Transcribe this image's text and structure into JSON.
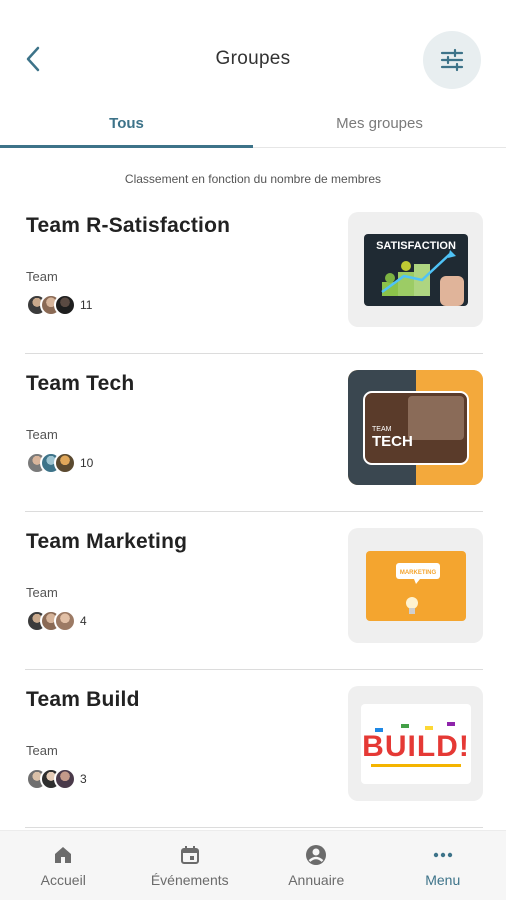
{
  "header": {
    "title": "Groupes",
    "back_icon": "chevron-left-icon",
    "filter_icon": "sliders-icon"
  },
  "tabs": [
    {
      "label": "Tous",
      "active": true
    },
    {
      "label": "Mes groupes",
      "active": false
    }
  ],
  "list_subtitle": "Classement en fonction du nombre de membres",
  "groups": [
    {
      "name": "Team R-Satisfaction",
      "type": "Team",
      "member_count": "11",
      "image": "satisfaction-image"
    },
    {
      "name": "Team Tech",
      "type": "Team",
      "member_count": "10",
      "image": "tech-image"
    },
    {
      "name": "Team Marketing",
      "type": "Team",
      "member_count": "4",
      "image": "marketing-image"
    },
    {
      "name": "Team Build",
      "type": "Team",
      "member_count": "3",
      "image": "build-image"
    }
  ],
  "thumb_text": {
    "satisfaction": "SATISFACTION",
    "tech_small": "TEAM",
    "tech_big": "TECH",
    "marketing": "MARKETING",
    "build": "BUILD!"
  },
  "bottom_nav": [
    {
      "label": "Accueil",
      "icon": "home-icon"
    },
    {
      "label": "Événements",
      "icon": "calendar-icon"
    },
    {
      "label": "Annuaire",
      "icon": "user-circle-icon"
    },
    {
      "label": "Menu",
      "icon": "more-icon",
      "active": true
    }
  ],
  "colors": {
    "accent": "#3d7389",
    "filter_bg": "#e8eef0",
    "nav_bg": "#f6f6f6"
  }
}
